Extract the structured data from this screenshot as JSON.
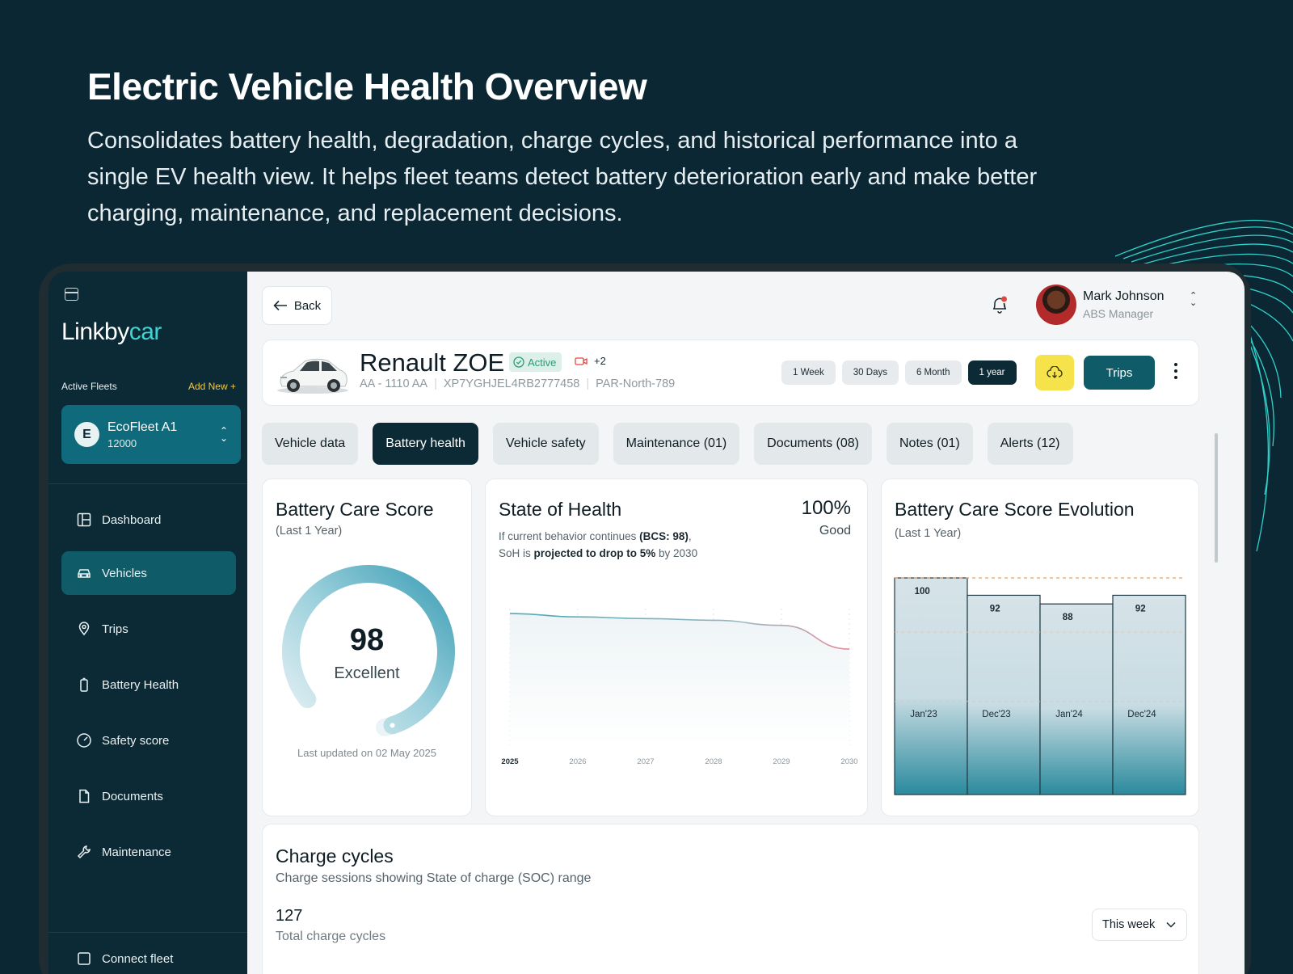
{
  "hero": {
    "title": "Electric Vehicle Health Overview",
    "subtitle": "Consolidates battery health, degradation, charge cycles, and historical performance into a single EV health view. It helps fleet teams detect battery deterioration early and make better charging, maintenance, and replacement decisions."
  },
  "sidebar": {
    "logo_main": "Linkby",
    "logo_accent": "car",
    "fleets_label": "Active Fleets",
    "add_new": "Add New +",
    "fleet": {
      "initial": "E",
      "name": "EcoFleet A1",
      "count": "12000"
    },
    "items": [
      {
        "label": "Dashboard",
        "icon": "dashboard-icon"
      },
      {
        "label": "Vehicles",
        "icon": "car-icon",
        "active": true
      },
      {
        "label": "Trips",
        "icon": "location-pin-icon"
      },
      {
        "label": "Battery Health",
        "icon": "battery-icon"
      },
      {
        "label": "Safety score",
        "icon": "gauge-icon"
      },
      {
        "label": "Documents",
        "icon": "document-icon"
      },
      {
        "label": "Maintenance",
        "icon": "wrench-icon"
      }
    ],
    "bottom_item_label": "Connect fleet"
  },
  "topbar": {
    "back_label": "Back",
    "user_name": "Mark Johnson",
    "user_role": "ABS Manager"
  },
  "vehicle": {
    "name": "Renault ZOE",
    "status": "Active",
    "extra_count": "+2",
    "plate": "AA - 1110 AA",
    "vin": "XP7YGHJEL4RB2777458",
    "location": "PAR-North-789",
    "ranges": [
      "1 Week",
      "30 Days",
      "6 Month",
      "1 year"
    ],
    "active_range": "1 year",
    "trips_label": "Trips"
  },
  "tabs": [
    {
      "label": "Vehicle data"
    },
    {
      "label": "Battery health",
      "active": true
    },
    {
      "label": "Vehicle safety"
    },
    {
      "label": "Maintenance (01)"
    },
    {
      "label": "Documents (08)"
    },
    {
      "label": "Notes (01)"
    },
    {
      "label": "Alerts (12)"
    }
  ],
  "care_score": {
    "title": "Battery Care Score",
    "period": "(Last 1 Year)",
    "value": "98",
    "value_number": 98,
    "max": 100,
    "label": "Excellent",
    "updated": "Last updated on 02 May 2025"
  },
  "soh": {
    "title": "State of Health",
    "percent": "100%",
    "status": "Good",
    "desc_part1": "If current behavior continues ",
    "desc_bold1": "(BCS: 98)",
    "desc_part2": ",",
    "desc_part3": "SoH is ",
    "desc_bold2": "projected to drop to 5%",
    "desc_part4": " by 2030"
  },
  "evolution": {
    "title": "Battery Care Score Evolution",
    "period": "(Last 1 Year)"
  },
  "chart_data": [
    {
      "type": "line",
      "title": "State of Health",
      "x": [
        "2025",
        "2026",
        "2027",
        "2028",
        "2029",
        "2030"
      ],
      "values": [
        100,
        98,
        97,
        96,
        93,
        79
      ],
      "ylim": [
        0,
        100
      ],
      "grid": "vertical dotted",
      "colors": {
        "start": "#4aa9b8",
        "end": "#e48b9a"
      }
    },
    {
      "type": "bar",
      "title": "Battery Care Score Evolution",
      "categories": [
        "Jan'23",
        "Dec'23",
        "Jan'24",
        "Dec'24"
      ],
      "values": [
        100,
        92,
        88,
        92
      ],
      "ylim": [
        0,
        100
      ],
      "reference_line": 100,
      "colors": {
        "top": "#d5e2e7",
        "bottom": "#2a8a9d",
        "reference": "#e9a063"
      }
    }
  ],
  "charge": {
    "title": "Charge cycles",
    "subtitle": "Charge sessions showing State of charge (SOC) range",
    "total": "127",
    "total_label": "Total charge cycles",
    "period": "This week"
  }
}
